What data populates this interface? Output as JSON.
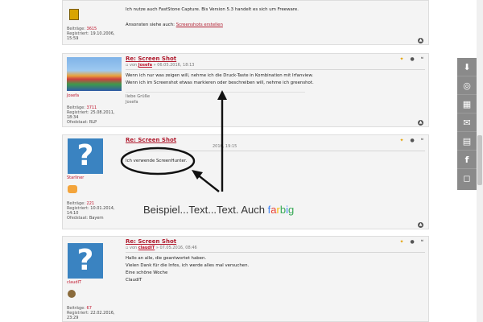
{
  "post0": {
    "text": "Ich nutze auch FastStone Capture. Bis Version 5.3 handelt es sich um Freeware.",
    "see_also_prefix": "Ansonsten siehe auch:",
    "see_also_link": "Screenshots erstellen",
    "beitraege_label": "Beiträge:",
    "beitraege": "3615",
    "registriert_label": "Registriert:",
    "registriert": "19.10.2006, 15:59"
  },
  "post1": {
    "title": "Re: Screen Shot",
    "meta_prefix": "von",
    "author": "Josefa",
    "date": "» 06.05.2016, 18:13",
    "username": "Josefa",
    "lines": [
      "Wenn ich nur was zeigen will, nehme ich die Druck-Taste in Kombination mit Irfanview.",
      "Wenn ich im Screenshot etwas markieren oder beschreiben will, nehme ich greenshot."
    ],
    "sig1": "liebe Grüße",
    "sig2": "Josefa",
    "beitraege_label": "Beiträge:",
    "beitraege": "3711",
    "registriert_label": "Registriert:",
    "registriert": "25.08.2011, 18:34",
    "ort_label": "Ofedstaat:",
    "ort": "RLP"
  },
  "post2": {
    "title": "Re: Screen Shot",
    "date": "2016, 19:15",
    "username": "Starliner",
    "text": "Ich verwende ScreenHunter.",
    "beitraege_label": "Beiträge:",
    "beitraege": "221",
    "registriert_label": "Registriert:",
    "registriert": "10.01.2014, 14:10",
    "ort_label": "Ofedstaat:",
    "ort": "Bayern",
    "annotation_text": "Beispiel...Text...Text. Auch",
    "annotation_colored": [
      "f",
      "a",
      "r",
      "b",
      "i",
      "g"
    ]
  },
  "post3": {
    "title": "Re: Screen Shot",
    "meta_prefix": "von",
    "author": "claudIT",
    "date": "» 07.05.2016, 08:46",
    "username": "claudIT",
    "lines": [
      "Hallo an alle, die geantwortet haben.",
      "Vielen Dank für die Infos, ich werde alles mal versuchen.",
      "Eine schöne Woche",
      "ClaudIT"
    ],
    "beitraege_label": "Beiträge:",
    "beitraege": "67",
    "registriert_label": "Registriert:",
    "registriert": "22.02.2016, 23:29"
  },
  "colors": {
    "accent": "#b01b2e",
    "avatar_blue": "#3a83c1",
    "rail": "#8a8a8a"
  },
  "rail_icons": [
    "download-icon",
    "chrome-icon",
    "table-icon",
    "chat-icon",
    "newspaper-icon",
    "facebook-icon",
    "instagram-icon"
  ]
}
